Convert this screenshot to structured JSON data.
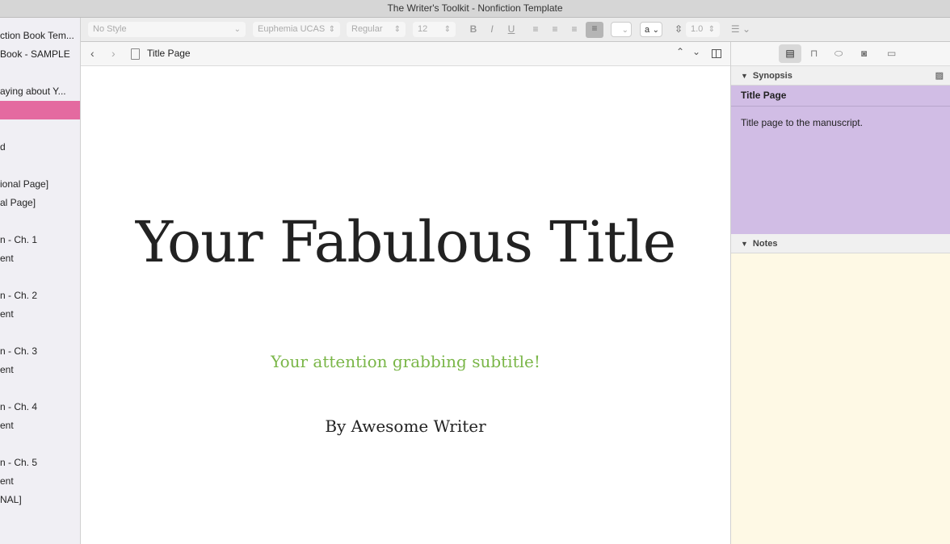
{
  "window": {
    "title": "The Writer's Toolkit - Nonfiction Template"
  },
  "binder": {
    "items": [
      "ction Book Tem...",
      "Book - SAMPLE",
      "",
      "aying about Y...",
      "",
      "",
      "d",
      "",
      "ional Page]",
      "al Page]",
      "",
      "n - Ch. 1",
      "ent",
      "",
      "n - Ch. 2",
      "ent",
      "",
      "n - Ch. 3",
      "ent",
      "",
      "n - Ch. 4",
      "ent",
      "",
      "n - Ch. 5",
      "ent",
      "NAL]"
    ],
    "selected_index": 4,
    "selected_color": "#e46aa0"
  },
  "toolbar": {
    "style": "No Style",
    "font": "Euphemia UCAS",
    "weight": "Regular",
    "size": "12",
    "line_spacing": "1.0",
    "text_color_label": "a"
  },
  "header": {
    "doc_title": "Title Page"
  },
  "document": {
    "title": "Your Fabulous Title",
    "subtitle": "Your attention grabbing subtitle!",
    "byline": "By  Awesome Writer",
    "subtitle_color": "#7ab648"
  },
  "inspector": {
    "synopsis_label": "Synopsis",
    "synopsis_title": "Title Page",
    "synopsis_text": "Title page to the manuscript.",
    "notes_label": "Notes",
    "synopsis_color": "#d1bde5",
    "notes_color": "#fef9e5"
  }
}
